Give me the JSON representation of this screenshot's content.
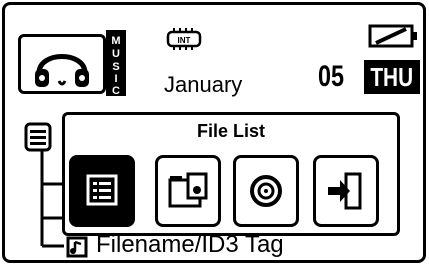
{
  "status": {
    "storage_badge": "INT",
    "music_label": "MUSIC",
    "month": "January",
    "day": "05",
    "weekday": "THU"
  },
  "icons": {
    "mode": "headphones-icon",
    "battery": "battery-empty-icon",
    "tree": "folder-icon"
  },
  "popup": {
    "title": "File List",
    "options": [
      {
        "name": "list-view-icon",
        "selected": true
      },
      {
        "name": "folder-file-icon",
        "selected": false
      },
      {
        "name": "disc-icon",
        "selected": false
      },
      {
        "name": "exit-icon",
        "selected": false
      }
    ]
  },
  "footer": {
    "text": "Filename/ID3 Tag",
    "icon": "music-file-icon"
  }
}
